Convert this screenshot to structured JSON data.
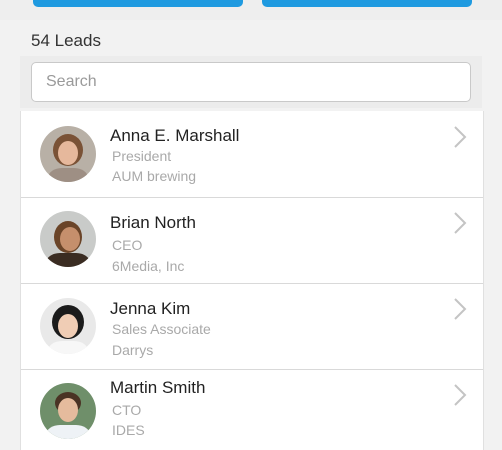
{
  "header": {
    "lead_count": "54 Leads"
  },
  "search": {
    "placeholder": "Search",
    "value": ""
  },
  "leads": [
    {
      "name": "Anna E. Marshall",
      "title": "President",
      "company": "AUM brewing"
    },
    {
      "name": "Brian North",
      "title": "CEO",
      "company": "6Media, Inc"
    },
    {
      "name": "Jenna Kim",
      "title": "Sales Associate",
      "company": "Darrys"
    },
    {
      "name": "Martin Smith",
      "title": "CTO",
      "company": "IDES"
    }
  ],
  "colors": {
    "accent": "#1f9ae0",
    "secondary_text": "#a9a9a9",
    "chevron": "#c4c4c4"
  },
  "icons": {
    "row_disclosure": "chevron-right-icon"
  }
}
